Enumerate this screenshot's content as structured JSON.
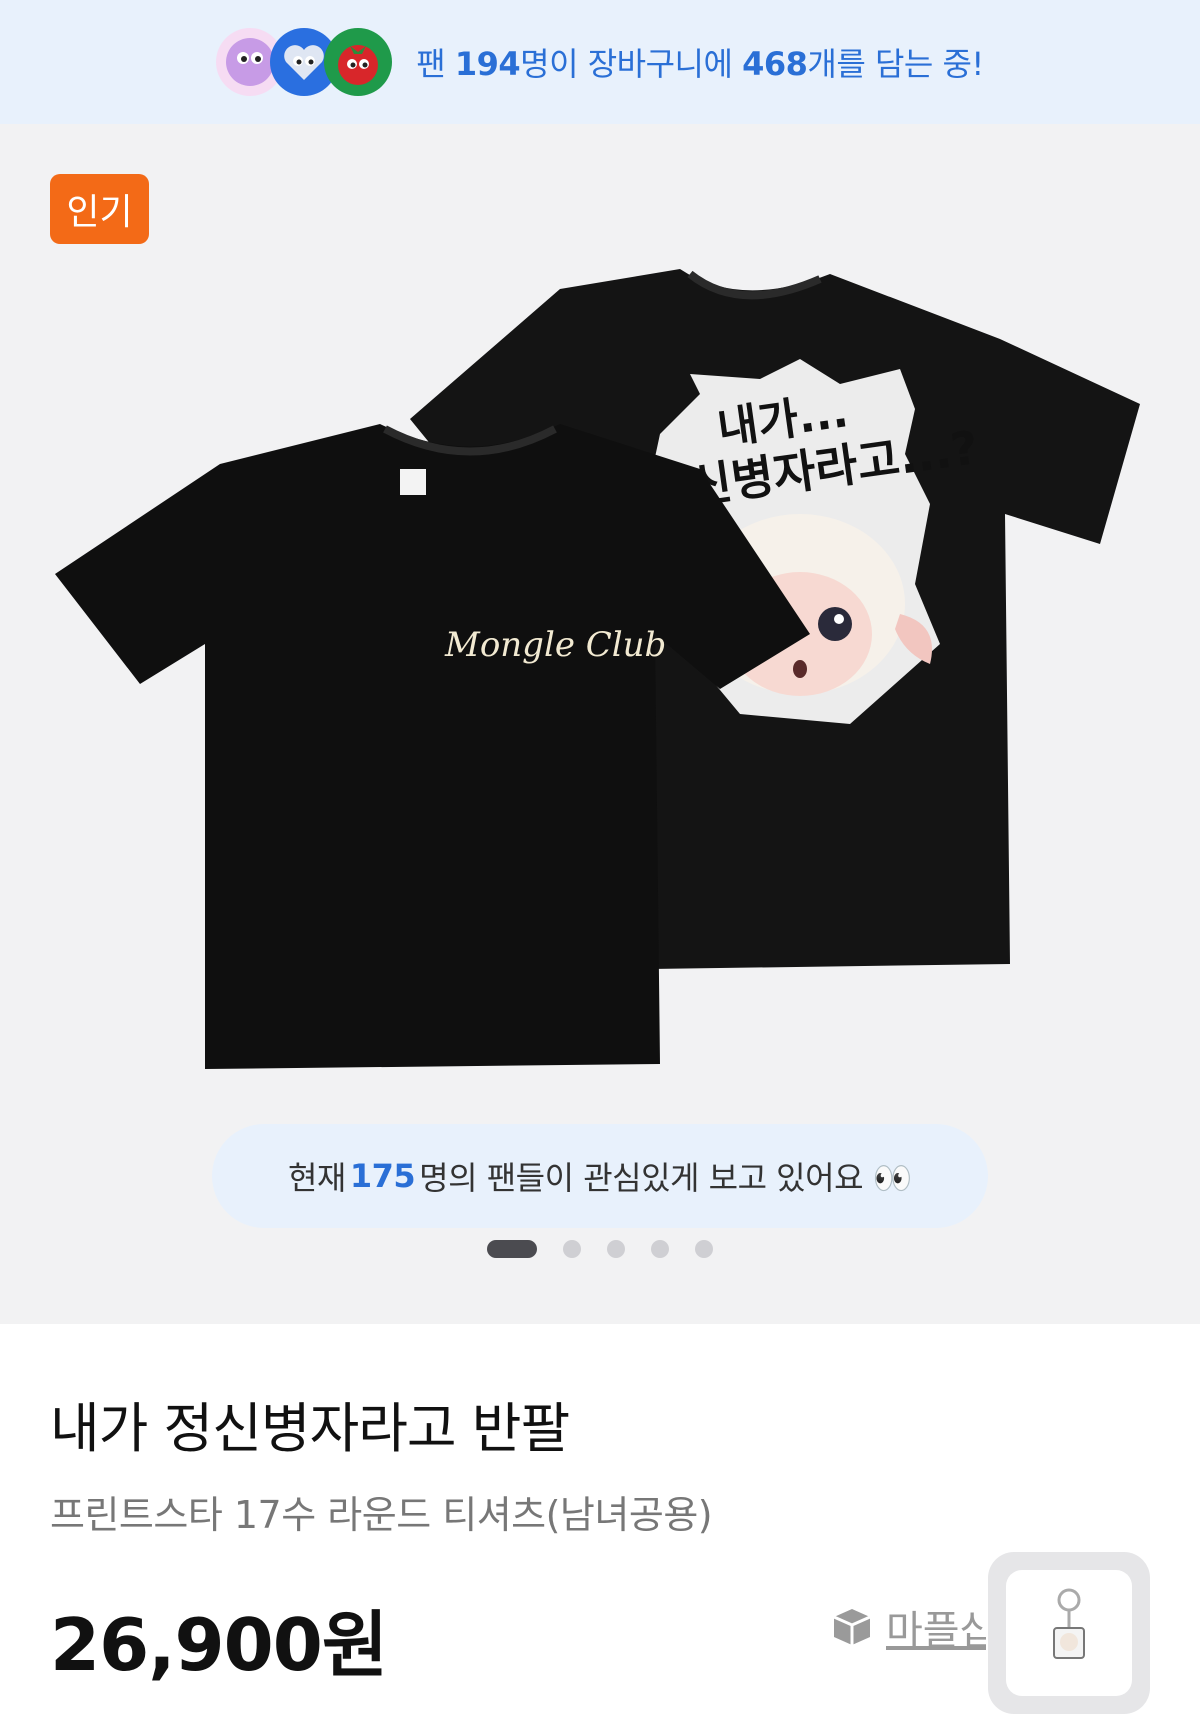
{
  "banner": {
    "prefix": "팬 ",
    "fans": "194",
    "middle": "명이 장바구니에 ",
    "items": "468",
    "suffix": "개를 담는 중!"
  },
  "hero": {
    "badge": "인기",
    "shirt_front_logo": "Mongle Club",
    "shirt_back_line1": "내가...",
    "shirt_back_line2": "정신병자라고...?",
    "viewers": {
      "prefix": "현재 ",
      "count": "175",
      "suffix": "명의 팬들이 관심있게 보고 있어요 👀"
    },
    "carousel": {
      "total": 5,
      "active": 1
    }
  },
  "product": {
    "title": "내가 정신병자라고 반팔",
    "subtitle": "프린트스타 17수 라운드 티셔츠(남녀공용)",
    "price": "26,900원",
    "shop_link": "마플샵"
  },
  "colors": {
    "accent": "#2a6fd6",
    "badge": "#f36a17",
    "banner_bg": "#e8f1fc"
  }
}
